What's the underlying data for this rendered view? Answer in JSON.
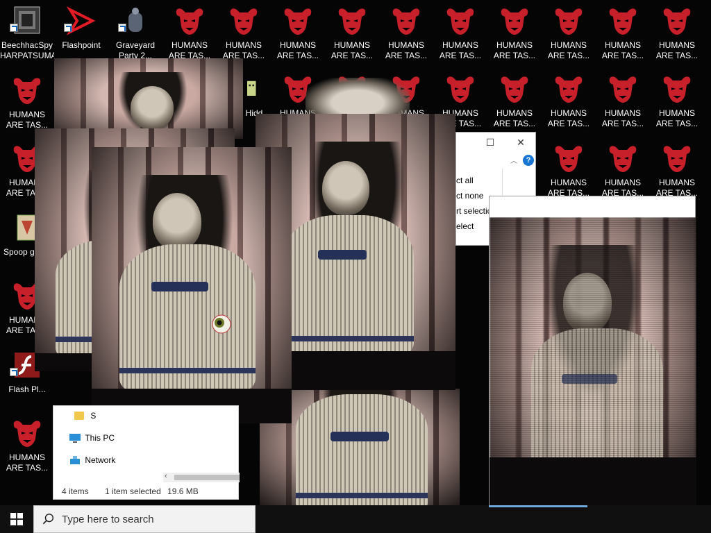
{
  "desktop": {
    "icons_top": [
      {
        "label": "BeechhacSpy HARPATSUMA",
        "glyph": "app-icon"
      },
      {
        "label": "Flashpoint",
        "glyph": "flashpoint-icon"
      },
      {
        "label": "Graveyard Party 2...",
        "glyph": "graveyard-icon"
      },
      {
        "label": "HUMANS ARE TAS...",
        "glyph": "demon-icon"
      },
      {
        "label": "HUMANS ARE TAS...",
        "glyph": "demon-icon"
      },
      {
        "label": "HUMANS ARE TAS...",
        "glyph": "demon-icon"
      },
      {
        "label": "HUMANS ARE TAS...",
        "glyph": "demon-icon"
      },
      {
        "label": "HUMANS ARE TAS...",
        "glyph": "demon-icon"
      },
      {
        "label": "HUMANS ARE TAS...",
        "glyph": "demon-icon"
      },
      {
        "label": "HUMANS ARE TAS...",
        "glyph": "demon-icon"
      },
      {
        "label": "HUMANS ARE TAS...",
        "glyph": "demon-icon"
      },
      {
        "label": "HUMANS ARE TAS...",
        "glyph": "demon-icon"
      },
      {
        "label": "HUMANS ARE TAS...",
        "glyph": "demon-icon"
      }
    ],
    "row2_label": "HUMANS ARE TAS...",
    "row2_partial": "HUMANS",
    "hidden_label": "Hidd",
    "left_icons": [
      {
        "label": "HUMANS ARE TAS...",
        "glyph": "demon-icon"
      },
      {
        "label": "HUMANS ARE TAS...",
        "glyph": "demon-icon"
      },
      {
        "label": "Spoop game",
        "glyph": "spoop-game-icon"
      },
      {
        "label": "HUMANS ARE TAS...",
        "glyph": "demon-icon"
      },
      {
        "label": "Flash Pl...",
        "glyph": "flash-player-icon"
      },
      {
        "label": "HUMANS ARE TAS...",
        "glyph": "demon-icon"
      }
    ]
  },
  "selection_window": {
    "items": [
      "ct all",
      "ct none",
      "rt selection",
      "elect"
    ],
    "minimize": "—",
    "maximize": "☐",
    "close": "✕",
    "help": "?"
  },
  "explorer": {
    "nav": [
      {
        "label": "S",
        "icon": "folder-icon"
      },
      {
        "label": "This PC",
        "icon": "this-pc-icon"
      },
      {
        "label": "Network",
        "icon": "network-icon"
      }
    ],
    "status": {
      "items": "4 items",
      "selected": "1 item selected",
      "size": "19.6 MB"
    }
  },
  "taskbar": {
    "search_placeholder": "Type here to search"
  },
  "colors": {
    "demon_red": "#c8202a",
    "taskbar": "#101010",
    "search_bg": "#f2f2f2"
  }
}
